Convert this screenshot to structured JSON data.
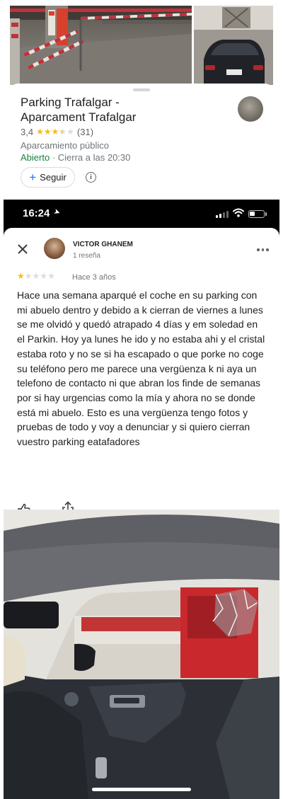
{
  "place": {
    "title": "Parking Trafalgar -\nAparcament Trafalgar",
    "rating": "3,4",
    "rating_value": 3.4,
    "review_count": "(31)",
    "type": "Aparcamiento público",
    "status_open": "Abierto",
    "status_hours": " · Cierra a las 20:30",
    "follow_label": "Seguir",
    "follow_icon": "plus-icon",
    "info_icon": "info-icon"
  },
  "status_bar": {
    "time": "16:24"
  },
  "review": {
    "reviewer_name": "VICTOR GHANEM",
    "reviewer_meta": "1 reseña",
    "stars": 1,
    "time": "Hace 3 años",
    "text": "Hace una semana aparqué el coche en su parking con mi abuelo dentro y debido a k cierran de viernes a lunes se me olvidó y quedó atrapado 4 días y em soledad en el Parkin. Hoy ya lunes he ido y no estaba ahi y el cristal estaba roto y no se si ha escapado o que porke no coge su teléfono pero me parece una vergüenza k ni aya un telefono de contacto ni que abran los finde de semanas por si hay urgencias como la mía y ahora no se donde está mi abuelo. Esto es una vergüenza tengo fotos y pruebas de todo y voy a denunciar y si quiero cierran vuestro parking eatafadores"
  },
  "colors": {
    "star": "#fbbc04",
    "star_empty": "#dadce0",
    "open_green": "#188038",
    "accent_blue": "#1a73e8",
    "text_primary": "#202124",
    "text_secondary": "#70757a"
  }
}
